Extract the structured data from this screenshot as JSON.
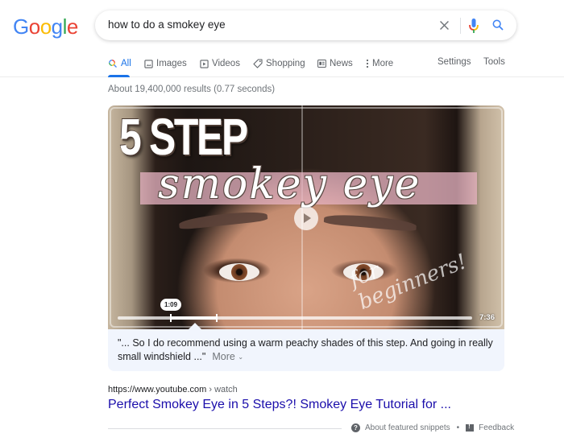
{
  "logo": {
    "letters": [
      {
        "char": "G",
        "color": "#4285F4"
      },
      {
        "char": "o",
        "color": "#EA4335"
      },
      {
        "char": "o",
        "color": "#FBBC05"
      },
      {
        "char": "g",
        "color": "#4285F4"
      },
      {
        "char": "l",
        "color": "#34A853"
      },
      {
        "char": "e",
        "color": "#EA4335"
      }
    ]
  },
  "search": {
    "query": "how to do a smokey eye",
    "clear_icon": "close-icon",
    "voice_icon": "mic-icon",
    "submit_icon": "search-icon"
  },
  "tabs": [
    {
      "label": "All",
      "icon": "search-icon",
      "active": true
    },
    {
      "label": "Images",
      "icon": "image-icon",
      "active": false
    },
    {
      "label": "Videos",
      "icon": "video-icon",
      "active": false
    },
    {
      "label": "Shopping",
      "icon": "tag-icon",
      "active": false
    },
    {
      "label": "News",
      "icon": "news-icon",
      "active": false
    },
    {
      "label": "More",
      "icon": "more-vert-icon",
      "active": false
    }
  ],
  "tools": {
    "settings": "Settings",
    "tools": "Tools"
  },
  "stats": "About 19,400,000 results (0.77 seconds)",
  "featured_snippet": {
    "video": {
      "thumbnail_text_big": "5 STEP",
      "thumbnail_text_script": "smokey eye",
      "thumbnail_text_sub": "for beginners!",
      "timestamp_marker": "1:09",
      "duration": "7:36",
      "highlight_start_fraction": 0.15,
      "highlight_end_fraction": 0.28
    },
    "quote": "\"... So I do recommend using a warm peachy shades of this step. And going in really small windshield ...\"",
    "more_label": "More",
    "more_icon": "chevron-down-icon"
  },
  "result": {
    "url": "https://www.youtube.com",
    "breadcrumb": "› watch",
    "title": "Perfect Smokey Eye in 5 Steps?! Smokey Eye Tutorial for ..."
  },
  "footer": {
    "about_label": "About featured snippets",
    "separator": "•",
    "feedback_label": "Feedback"
  }
}
